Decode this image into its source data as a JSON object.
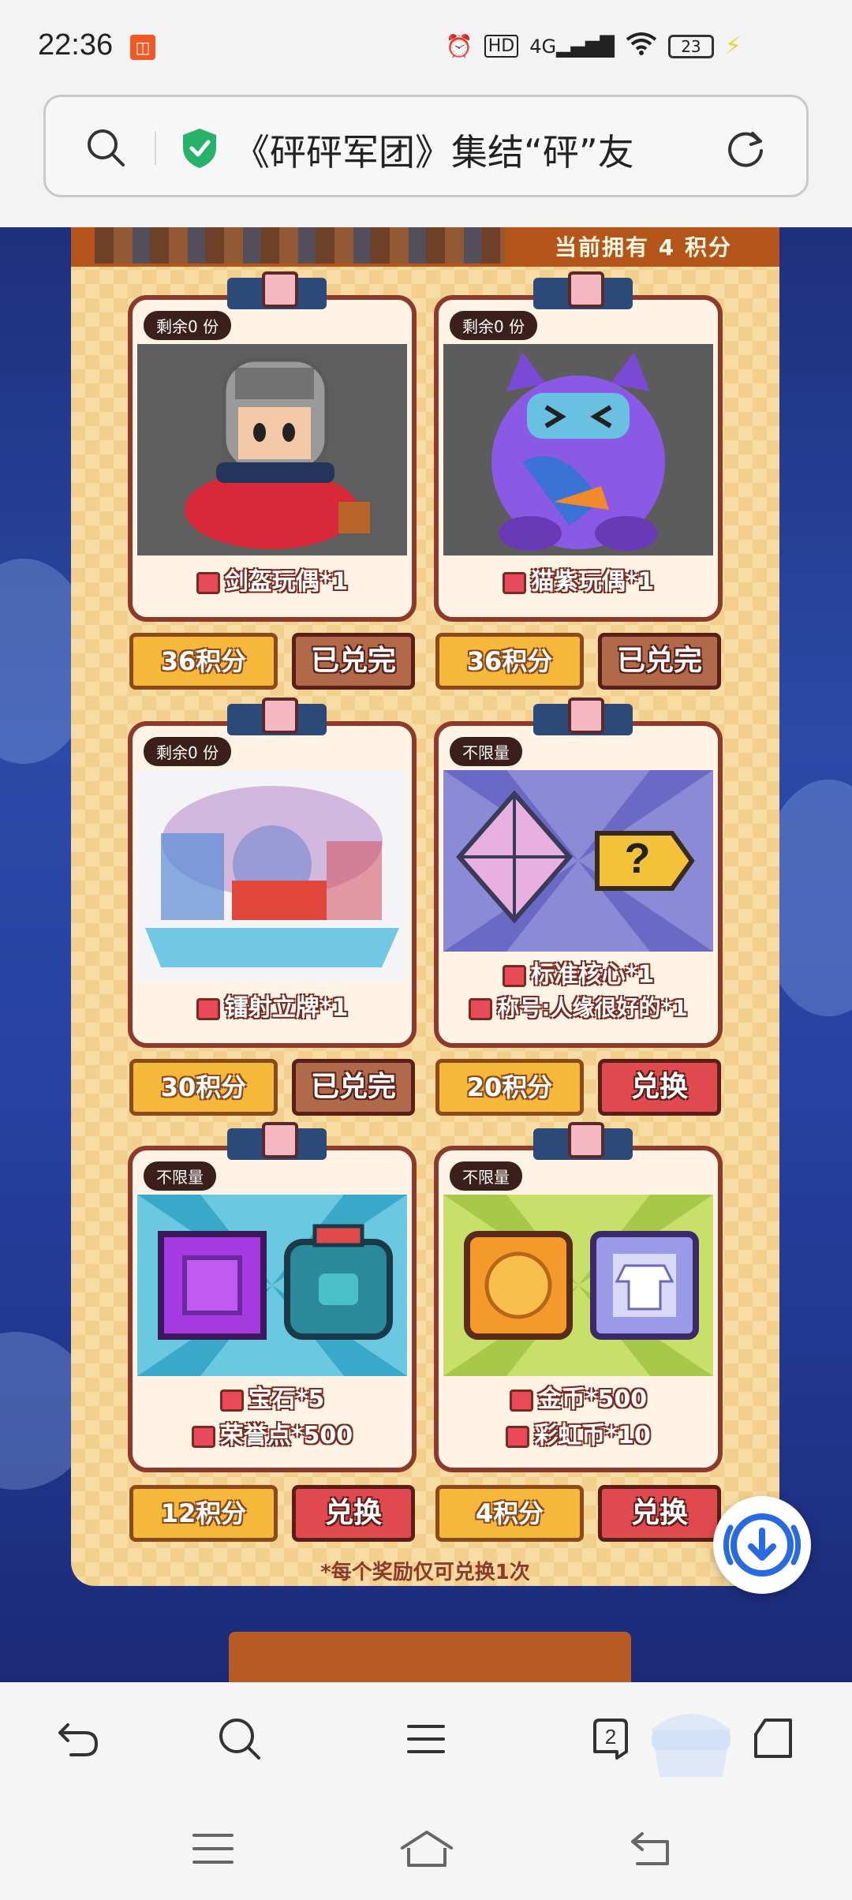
{
  "status_bar": {
    "time": "22:36",
    "battery": "23",
    "icons": [
      "alarm-icon",
      "hd-icon",
      "signal-4g-icon",
      "wifi-icon",
      "battery-icon",
      "charging-icon"
    ]
  },
  "address_bar": {
    "title": "《砰砰军团》集结“砰”友",
    "icons": [
      "search-icon",
      "shield-check-icon",
      "refresh-icon"
    ]
  },
  "page": {
    "points_label": "当前拥有 4 积分",
    "items": [
      {
        "tag": "剩余0 份",
        "rewards": [
          "剑盔玩偶*1"
        ],
        "price": "36积分",
        "action": "已兑完",
        "state": "done"
      },
      {
        "tag": "剩余0 份",
        "rewards": [
          "猫紫玩偶*1"
        ],
        "price": "36积分",
        "action": "已兑完",
        "state": "done"
      },
      {
        "tag": "剩余0 份",
        "rewards": [
          "镭射立牌*1"
        ],
        "price": "30积分",
        "action": "已兑完",
        "state": "done"
      },
      {
        "tag": "不限量",
        "rewards": [
          "标准核心*1",
          "称号:人缘很好的*1"
        ],
        "price": "20积分",
        "action": "兑换",
        "state": "active"
      },
      {
        "tag": "不限量",
        "rewards": [
          "宝石*5",
          "荣誉点*500"
        ],
        "price": "12积分",
        "action": "兑换",
        "state": "active"
      },
      {
        "tag": "不限量",
        "rewards": [
          "金币*500",
          "彩虹币*10"
        ],
        "price": "4积分",
        "action": "兑换",
        "state": "active"
      }
    ],
    "note": "*每个奖励仅可兑换1次"
  },
  "browser_toolbar": {
    "tab_count": "2",
    "icons": [
      "back-icon",
      "search-icon",
      "menu-icon",
      "tabs-icon",
      "home-icon"
    ]
  },
  "system_nav": {
    "icons": [
      "recents-icon",
      "home-icon",
      "back-icon"
    ]
  },
  "colors": {
    "panel": "#f2cf8c",
    "card_border": "#8c3a2c",
    "price_bg": "#f6b83a",
    "btn_active": "#e04a4e",
    "btn_done": "#b06a4a",
    "page_bg": "#2b4aa6"
  }
}
